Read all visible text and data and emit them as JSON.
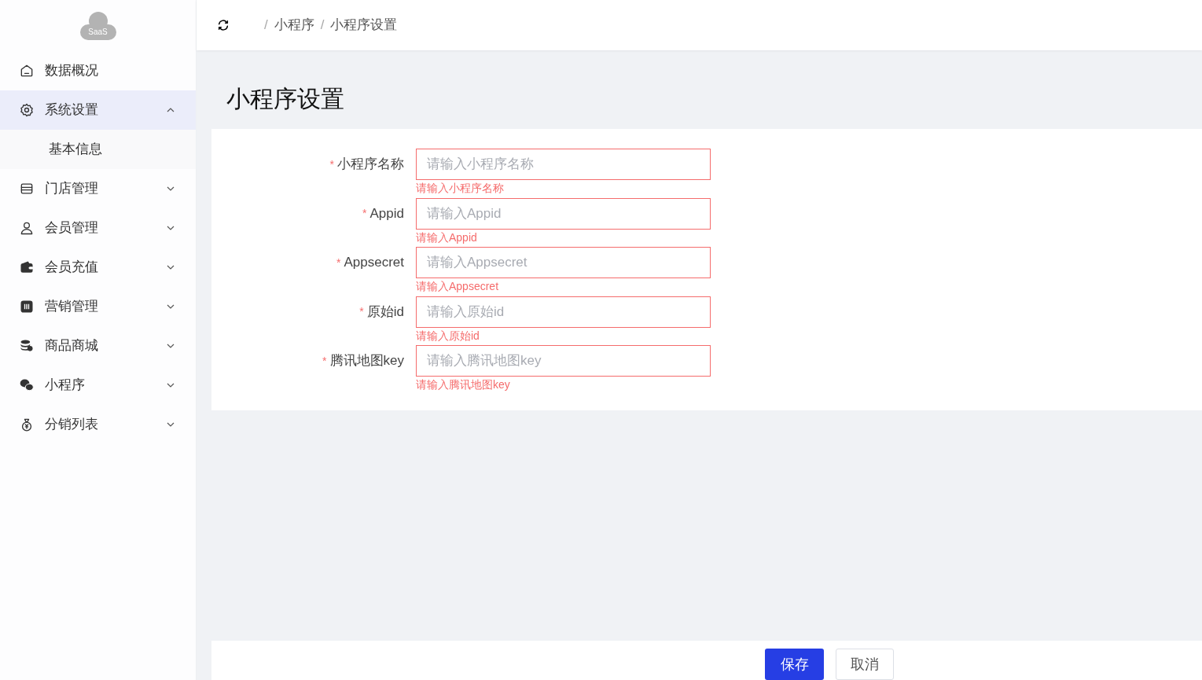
{
  "logo": {
    "text": "SaaS"
  },
  "sidebar": {
    "items": [
      {
        "label": "数据概况",
        "selected": false
      },
      {
        "label": "系统设置",
        "selected": true,
        "expanded": true,
        "children": [
          {
            "label": "基本信息",
            "selected": false
          }
        ]
      },
      {
        "label": "门店管理",
        "selected": false,
        "expanded": false
      },
      {
        "label": "会员管理",
        "selected": false,
        "expanded": false
      },
      {
        "label": "会员充值",
        "selected": false,
        "expanded": false
      },
      {
        "label": "营销管理",
        "selected": false,
        "expanded": false
      },
      {
        "label": "商品商城",
        "selected": false,
        "expanded": false
      },
      {
        "label": "小程序",
        "selected": false,
        "expanded": false
      },
      {
        "label": "分销列表",
        "selected": false,
        "expanded": false
      }
    ]
  },
  "breadcrumb": [
    {
      "separator": "/",
      "label": "小程序"
    },
    {
      "separator": "/",
      "label": "小程序设置"
    }
  ],
  "page_title": "小程序设置",
  "form": {
    "fields": [
      {
        "label": "小程序名称",
        "required_mark": "*",
        "placeholder": "请输入小程序名称",
        "error": "请输入小程序名称"
      },
      {
        "label": "Appid",
        "required_mark": "*",
        "placeholder": "请输入Appid",
        "error": "请输入Appid"
      },
      {
        "label": "Appsecret",
        "required_mark": "*",
        "placeholder": "请输入Appsecret",
        "error": "请输入Appsecret"
      },
      {
        "label": "原始id",
        "required_mark": "*",
        "placeholder": "请输入原始id",
        "error": "请输入原始id"
      },
      {
        "label": "腾讯地图key",
        "required_mark": "*",
        "placeholder": "请输入腾讯地图key",
        "error": "请输入腾讯地图key"
      }
    ]
  },
  "buttons": [
    {
      "label": "保存",
      "kind": "primary"
    },
    {
      "label": "取消",
      "kind": "default"
    }
  ]
}
